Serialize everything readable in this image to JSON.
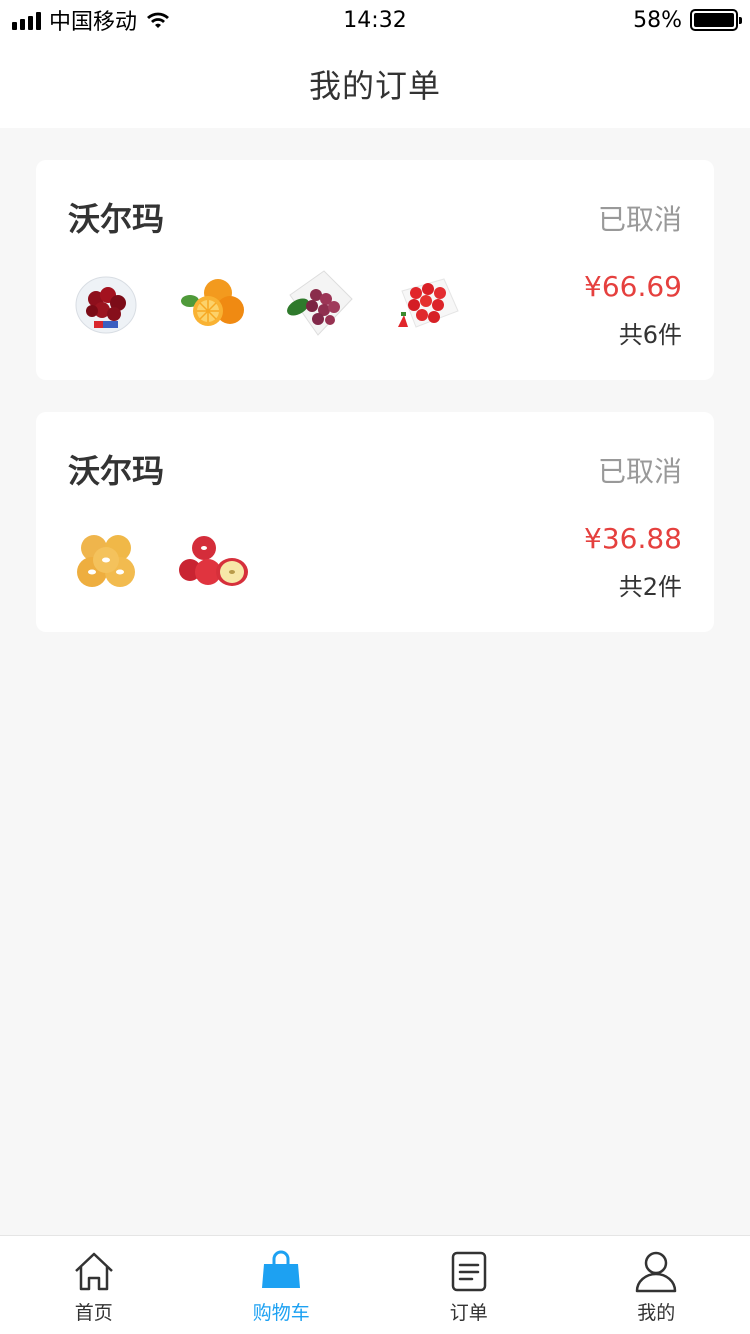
{
  "status_bar": {
    "carrier": "中国移动",
    "time": "14:32",
    "battery": "58%"
  },
  "header": {
    "title": "我的订单"
  },
  "orders": [
    {
      "store": "沃尔玛",
      "status": "已取消",
      "price": "¥66.69",
      "count": "共6件",
      "items": [
        "cherry-icon",
        "orange-icon",
        "grape-icon",
        "strawberry-icon"
      ]
    },
    {
      "store": "沃尔玛",
      "status": "已取消",
      "price": "¥36.88",
      "count": "共2件",
      "items": [
        "pear-icon",
        "apple-icon"
      ]
    }
  ],
  "tab_bar": {
    "active": "购物车",
    "tabs": [
      {
        "label": "首页",
        "icon": "home-icon"
      },
      {
        "label": "购物车",
        "icon": "shopping-bag-icon"
      },
      {
        "label": "订单",
        "icon": "order-list-icon"
      },
      {
        "label": "我的",
        "icon": "user-icon"
      }
    ]
  },
  "colors": {
    "accent": "#1da1f2",
    "price": "#e5403e",
    "status": "#999999",
    "background": "#f7f7f7"
  }
}
